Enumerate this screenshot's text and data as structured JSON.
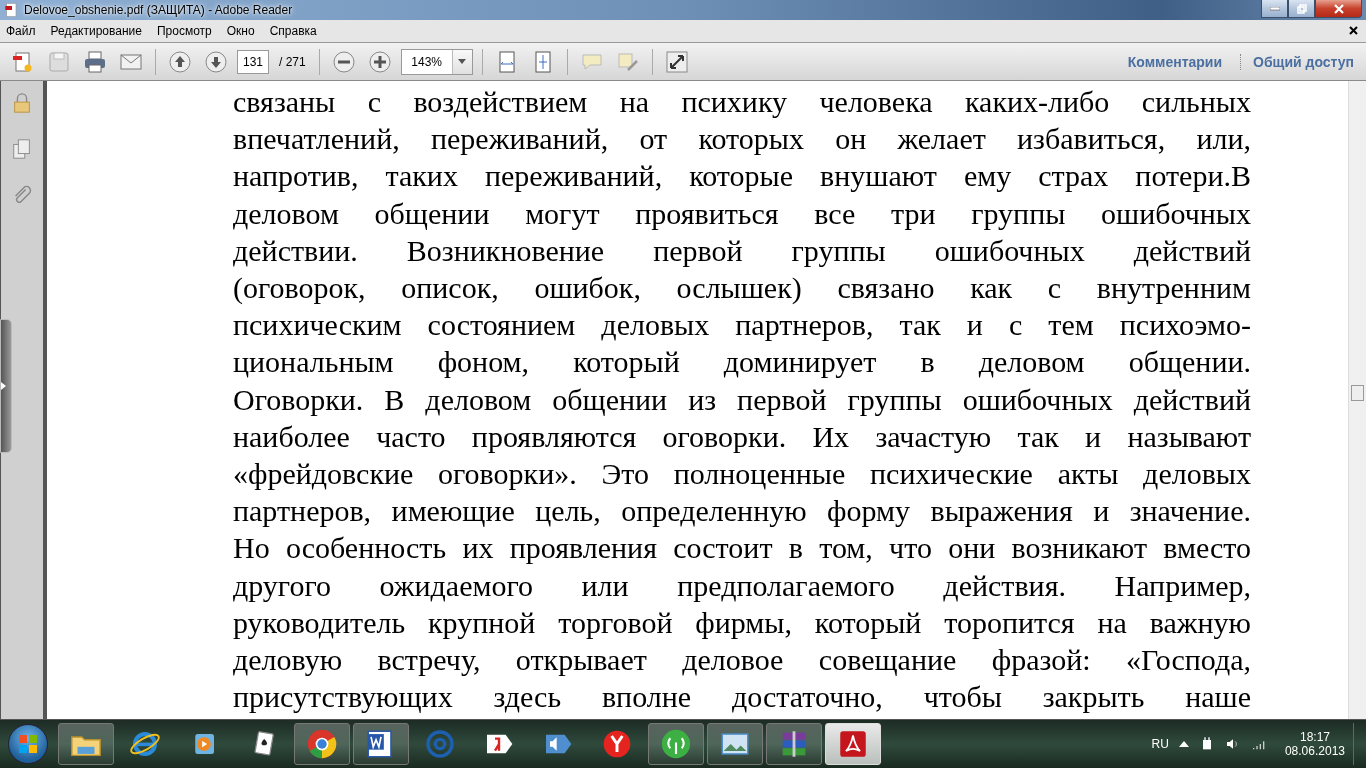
{
  "window": {
    "title": "Delovoe_obshenie.pdf (ЗАЩИТА) - Adobe Reader"
  },
  "menu": [
    "Файл",
    "Редактирование",
    "Просмотр",
    "Окно",
    "Справка"
  ],
  "toolbar": {
    "page": "131",
    "page_total": "/ 271",
    "zoom": "143%",
    "links": [
      "Комментарии",
      "Общий доступ"
    ]
  },
  "document": {
    "lines": [
      "связаны с воздействием на психику человека каких-либо сильных",
      "впечатлений, переживаний, от которых он желает избавиться, или,",
      "напротив, таких переживаний, которые внушают ему страх потери.В",
      "деловом общении могут проявиться все три группы ошибочных",
      "действии. Возникновение первой группы ошибочных действий",
      "(оговорок, описок, ошибок, ослышек) связано как с внутренним",
      "психическим состоянием деловых партнеров, так и с тем психоэмо-",
      "циональным фоном, который доминирует в деловом общении.",
      "Оговорки. В деловом общении из первой группы ошибочных действий",
      "наиболее часто проявляются оговорки. Их зачастую так и называют",
      "«фрейдовские оговорки». Это полноценные психические акты деловых",
      "партнеров, имеющие цель, определенную форму выражения и значение.",
      "Но особенность их проявления состоит в том, что они возникают вместо",
      "другого ожидаемого или предполагаемого действия. Например,",
      "руководитель крупной торговой фирмы, который торопится на важную",
      "деловую встречу, открывает деловое совещание фразой: «Господа,",
      "присутствующих здесь вполне достаточно, чтобы закрыть наше"
    ]
  },
  "taskbar": {
    "apps": [
      {
        "kind": "explorer",
        "running": true,
        "selected": false
      },
      {
        "kind": "ie",
        "running": false,
        "selected": false
      },
      {
        "kind": "media",
        "running": false,
        "selected": false
      },
      {
        "kind": "cards",
        "running": false,
        "selected": false
      },
      {
        "kind": "chrome",
        "running": true,
        "selected": false
      },
      {
        "kind": "word",
        "running": true,
        "selected": false
      },
      {
        "kind": "mail",
        "running": false,
        "selected": false
      },
      {
        "kind": "yandex",
        "running": false,
        "selected": false
      },
      {
        "kind": "sound",
        "running": false,
        "selected": false
      },
      {
        "kind": "ybrowser",
        "running": false,
        "selected": false
      },
      {
        "kind": "antenna",
        "running": true,
        "selected": false
      },
      {
        "kind": "photo",
        "running": true,
        "selected": false
      },
      {
        "kind": "archive",
        "running": true,
        "selected": false
      },
      {
        "kind": "pdf",
        "running": true,
        "selected": true
      }
    ],
    "tray": {
      "language": "RU",
      "time": "18:17",
      "date": "08.06.2013"
    }
  }
}
